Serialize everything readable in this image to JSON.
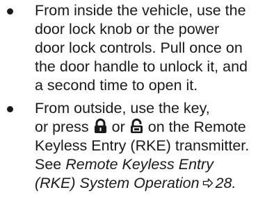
{
  "bullets": [
    {
      "lines": [
        "From inside the vehicle, use the",
        "door lock knob or the power",
        "door lock controls. Pull once on",
        "the door handle to unlock it, and",
        "a second time to open it."
      ]
    },
    {
      "line1": "From outside, use the key,",
      "line2_before": "or press",
      "line2_between": "or",
      "line2_after": "on the Remote",
      "line3": "Keyless Entry (RKE) transmitter.",
      "line4_plain": "See",
      "line4_italic": "Remote Keyless Entry",
      "line5_italic": "(RKE) System Operation",
      "line5_page": "28",
      "line5_end": ".",
      "icons": [
        "lock-closed-icon",
        "unlock-icon",
        "page-ref-arrow-icon"
      ]
    }
  ],
  "colors": {
    "text": "#1a1a1a",
    "background": "#ffffff"
  }
}
